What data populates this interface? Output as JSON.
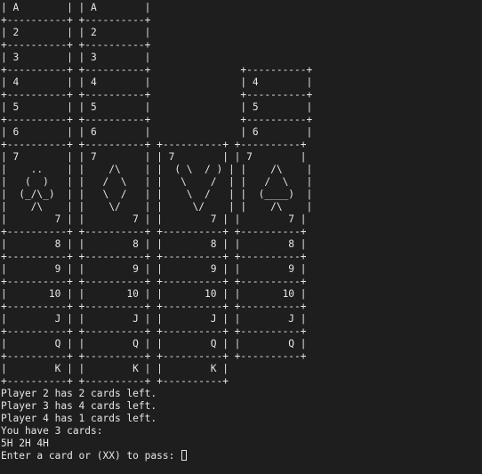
{
  "terminal": {
    "lines": [
      "| A        | | A        |",
      "+----------+ +----------+",
      "| 2        | | 2        |",
      "+----------+ +----------+",
      "| 3        | | 3        |",
      "+----------+ +----------+               +----------+",
      "| 4        | | 4        |               | 4        |",
      "+----------+ +----------+               +----------+",
      "| 5        | | 5        |               | 5        |",
      "+----------+ +----------+               +----------+",
      "| 6        | | 6        |               | 6        |",
      "+----------+ +----------+ +----------+ +----------+",
      "| 7        | | 7        | | 7        | | 7        |",
      "|    ..    | |    /\\    | |  ( \\  / ) | |    /\\    |",
      "|   (  )   | |   /  \\   | |   \\    /  | |   /  \\   |",
      "|  (_/\\_)  | |   \\  /   | |    \\  /   | |  (____)  |",
      "|    /\\    | |    \\/    | |     \\/    | |    /\\    |",
      "|        7 | |        7 | |        7 | |        7 |",
      "+----------+ +----------+ +----------+ +----------+",
      "|        8 | |        8 | |        8 | |        8 |",
      "+----------+ +----------+ +----------+ +----------+",
      "|        9 | |        9 | |        9 | |        9 |",
      "+----------+ +----------+ +----------+ +----------+",
      "|       10 | |       10 | |       10 | |       10 |",
      "+----------+ +----------+ +----------+ +----------+",
      "|        J | |        J | |        J | |        J |",
      "+----------+ +----------+ +----------+ +----------+",
      "|        Q | |        Q | |        Q | |        Q |",
      "+----------+ +----------+ +----------+ +----------+",
      "|        K | |        K | |        K |",
      "+----------+ +----------+ +----------+",
      "Player 2 has 2 cards left.",
      "Player 3 has 4 cards left.",
      "Player 4 has 1 cards left.",
      "You have 3 cards:",
      "5H 2H 4H"
    ],
    "prompt": "Enter a card or (XX) to pass: ",
    "input_value": ""
  }
}
